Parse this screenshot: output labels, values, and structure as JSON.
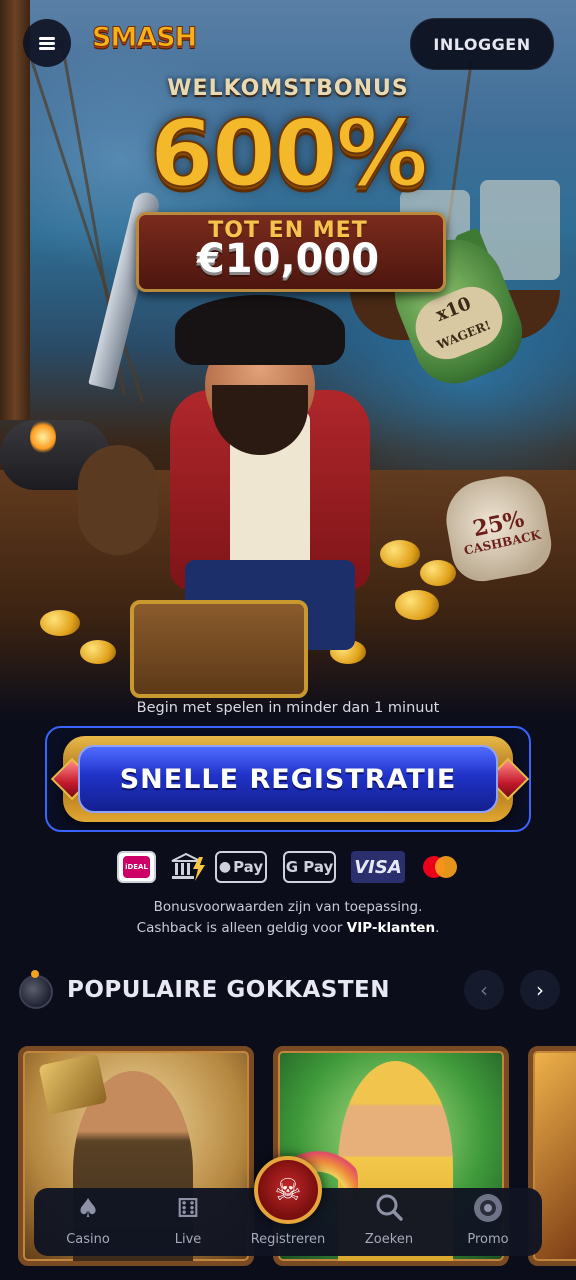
{
  "header": {
    "logo_text": "SMASH",
    "login_label": "INLOGGEN"
  },
  "hero": {
    "welcome": "WELKOMSTBONUS",
    "percent": "600%",
    "upto": "TOT EN MET",
    "amount": "€10,000",
    "wager_line1": "x10",
    "wager_line2": "WAGER!",
    "cashback_line1": "25%",
    "cashback_line2": "CASHBACK"
  },
  "registration": {
    "subline": "Begin met spelen in minder dan 1 minuut",
    "button_label": "SNELLE REGISTRATIE"
  },
  "payments": {
    "ideal": "iDEAL",
    "apple_pay": "Pay",
    "google_pay": "G Pay",
    "visa": "VISA"
  },
  "terms": {
    "line1": "Bonusvoorwaarden zijn van toepassing.",
    "line2_prefix": "Cashback is alleen geldig voor ",
    "line2_bold": "VIP-klanten",
    "line2_suffix": "."
  },
  "popular": {
    "title": "POPULAIRE GOKKASTEN",
    "prev_icon": "chevron-left-icon",
    "next_icon": "chevron-right-icon"
  },
  "bottom_nav": {
    "items": [
      {
        "label": "Casino",
        "icon": "spade-icon"
      },
      {
        "label": "Live",
        "icon": "dice-icon"
      },
      {
        "label": "Registreren",
        "icon": "skull-icon"
      },
      {
        "label": "Zoeken",
        "icon": "search-icon"
      },
      {
        "label": "Promo",
        "icon": "promo-chip-icon"
      }
    ]
  },
  "colors": {
    "background": "#0b0d1a",
    "accent_gold": "#f4b92a",
    "button_blue": "#2032c8",
    "frame_blue": "#3a64ff"
  }
}
